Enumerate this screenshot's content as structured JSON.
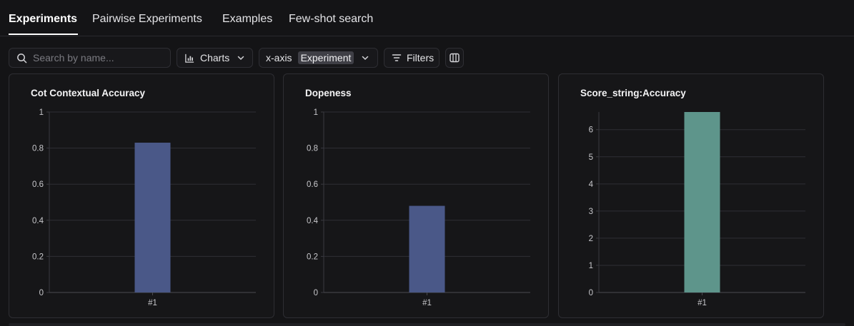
{
  "tabs": [
    {
      "label": "Experiments",
      "active": true
    },
    {
      "label": "Pairwise Experiments",
      "active": false
    },
    {
      "label": "Examples",
      "active": false
    },
    {
      "label": "Few-shot search",
      "active": false
    }
  ],
  "toolbar": {
    "search_placeholder": "Search by name...",
    "charts_label": "Charts",
    "xaxis_label": "x-axis",
    "xaxis_value": "Experiment",
    "filters_label": "Filters"
  },
  "colors": {
    "background": "#141416",
    "bar_blue": "#4a5888",
    "bar_green": "#5e958b"
  },
  "chart_data": [
    {
      "type": "bar",
      "title": "Cot Contextual Accuracy",
      "categories": [
        "#1"
      ],
      "values": [
        0.83
      ],
      "ylim": [
        0,
        1
      ],
      "yticks": [
        "0",
        "0.2",
        "0.4",
        "0.6",
        "0.8",
        "1"
      ],
      "color": "#4a5888",
      "grid": true
    },
    {
      "type": "bar",
      "title": "Dopeness",
      "categories": [
        "#1"
      ],
      "values": [
        0.48
      ],
      "ylim": [
        0,
        1
      ],
      "yticks": [
        "0",
        "0.2",
        "0.4",
        "0.6",
        "0.8",
        "1"
      ],
      "color": "#4a5888",
      "grid": true
    },
    {
      "type": "bar",
      "title": "Score_string:Accuracy",
      "categories": [
        "#1"
      ],
      "values": [
        6.65
      ],
      "ylim": [
        0,
        6.65
      ],
      "yticks": [
        "0",
        "1",
        "2",
        "3",
        "4",
        "5",
        "6"
      ],
      "color": "#5e958b",
      "grid": true
    }
  ]
}
